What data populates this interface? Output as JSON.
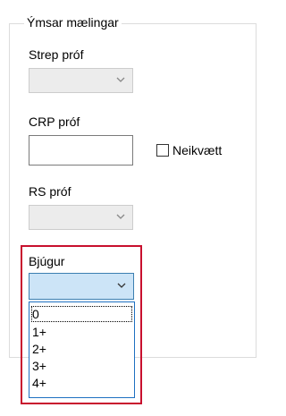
{
  "group": {
    "title": "Ýmsar mælingar"
  },
  "strep": {
    "label": "Strep próf",
    "value": ""
  },
  "crp": {
    "label": "CRP próf",
    "value": "",
    "checkbox_label": "Neikvætt",
    "checked": false
  },
  "rs": {
    "label": "RS próf",
    "value": ""
  },
  "bjugur": {
    "label": "Bjúgur",
    "value": "",
    "options": [
      "0",
      "1+",
      "2+",
      "3+",
      "4+"
    ]
  },
  "colors": {
    "highlight": "#c8102e",
    "selection": "#cce4f7",
    "dropdown_border": "#1e70c1"
  }
}
